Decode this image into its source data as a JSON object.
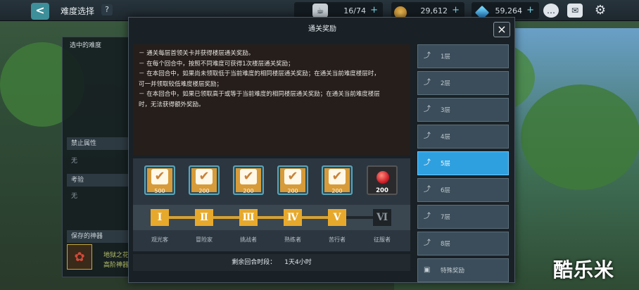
{
  "topbar": {
    "back_label": "<",
    "title": "难度选择",
    "help_label": "?",
    "resources": [
      {
        "name": "stamina",
        "value": "16/74",
        "plus": "+"
      },
      {
        "name": "gold",
        "value": "29,612",
        "plus": "+"
      },
      {
        "name": "gem",
        "value": "59,264",
        "plus": "+"
      }
    ],
    "icons": [
      "chat-icon",
      "mail-icon",
      "gear-icon"
    ]
  },
  "left_panel": {
    "selected_difficulty_label": "选中的难度",
    "forbidden_attr_label": "禁止属性",
    "forbidden_attr_value": "无",
    "trial_label": "考验",
    "trial_value": "无",
    "saved_artifact_label": "保存的神器",
    "artifact_name": "地狱之花",
    "artifact_tier": "高阶神器"
  },
  "modal": {
    "title": "通关奖励",
    "close_label": "×",
    "description": [
      "－ 通关每层首领关卡并获得楼层通关奖励。",
      "－ 在每个回合中，按照不同难度可获得1次楼层通关奖励；",
      "－ 在本回合中，如果尚未领取低于当前难度的相同楼层通关奖励；在通关当前难度楼层时，",
      "可一并领取较低难度楼层奖励；",
      "－ 在本回合中，如果已领取高于或等于当前难度的相同楼层通关奖励；在通关当前难度楼层",
      "时，无法获得额外奖励。"
    ],
    "rewards": [
      {
        "amount": "500",
        "claimed": true,
        "rank_numeral": "Ⅰ",
        "rank_name": "观光客"
      },
      {
        "amount": "200",
        "claimed": true,
        "rank_numeral": "Ⅱ",
        "rank_name": "冒险家"
      },
      {
        "amount": "200",
        "claimed": true,
        "rank_numeral": "Ⅲ",
        "rank_name": "挑战者"
      },
      {
        "amount": "200",
        "claimed": true,
        "rank_numeral": "Ⅳ",
        "rank_name": "熟练者"
      },
      {
        "amount": "200",
        "claimed": true,
        "rank_numeral": "Ⅴ",
        "rank_name": "苦行者"
      },
      {
        "amount": "200",
        "claimed": false,
        "rank_numeral": "Ⅵ",
        "rank_name": "征服者"
      }
    ],
    "timer_label": "剩余回合时段：",
    "timer_value": "1天4小时",
    "floors": [
      {
        "label": "1层",
        "selected": false
      },
      {
        "label": "2层",
        "selected": false
      },
      {
        "label": "3层",
        "selected": false
      },
      {
        "label": "4层",
        "selected": false
      },
      {
        "label": "5层",
        "selected": true
      },
      {
        "label": "6层",
        "selected": false
      },
      {
        "label": "7层",
        "selected": false
      },
      {
        "label": "8层",
        "selected": false
      },
      {
        "label": "特殊奖励",
        "selected": false
      }
    ]
  },
  "watermark": "酷乐米",
  "colors": {
    "accent": "#2ea0e0",
    "gold": "#e7a92c",
    "panel": "#1a2126"
  }
}
